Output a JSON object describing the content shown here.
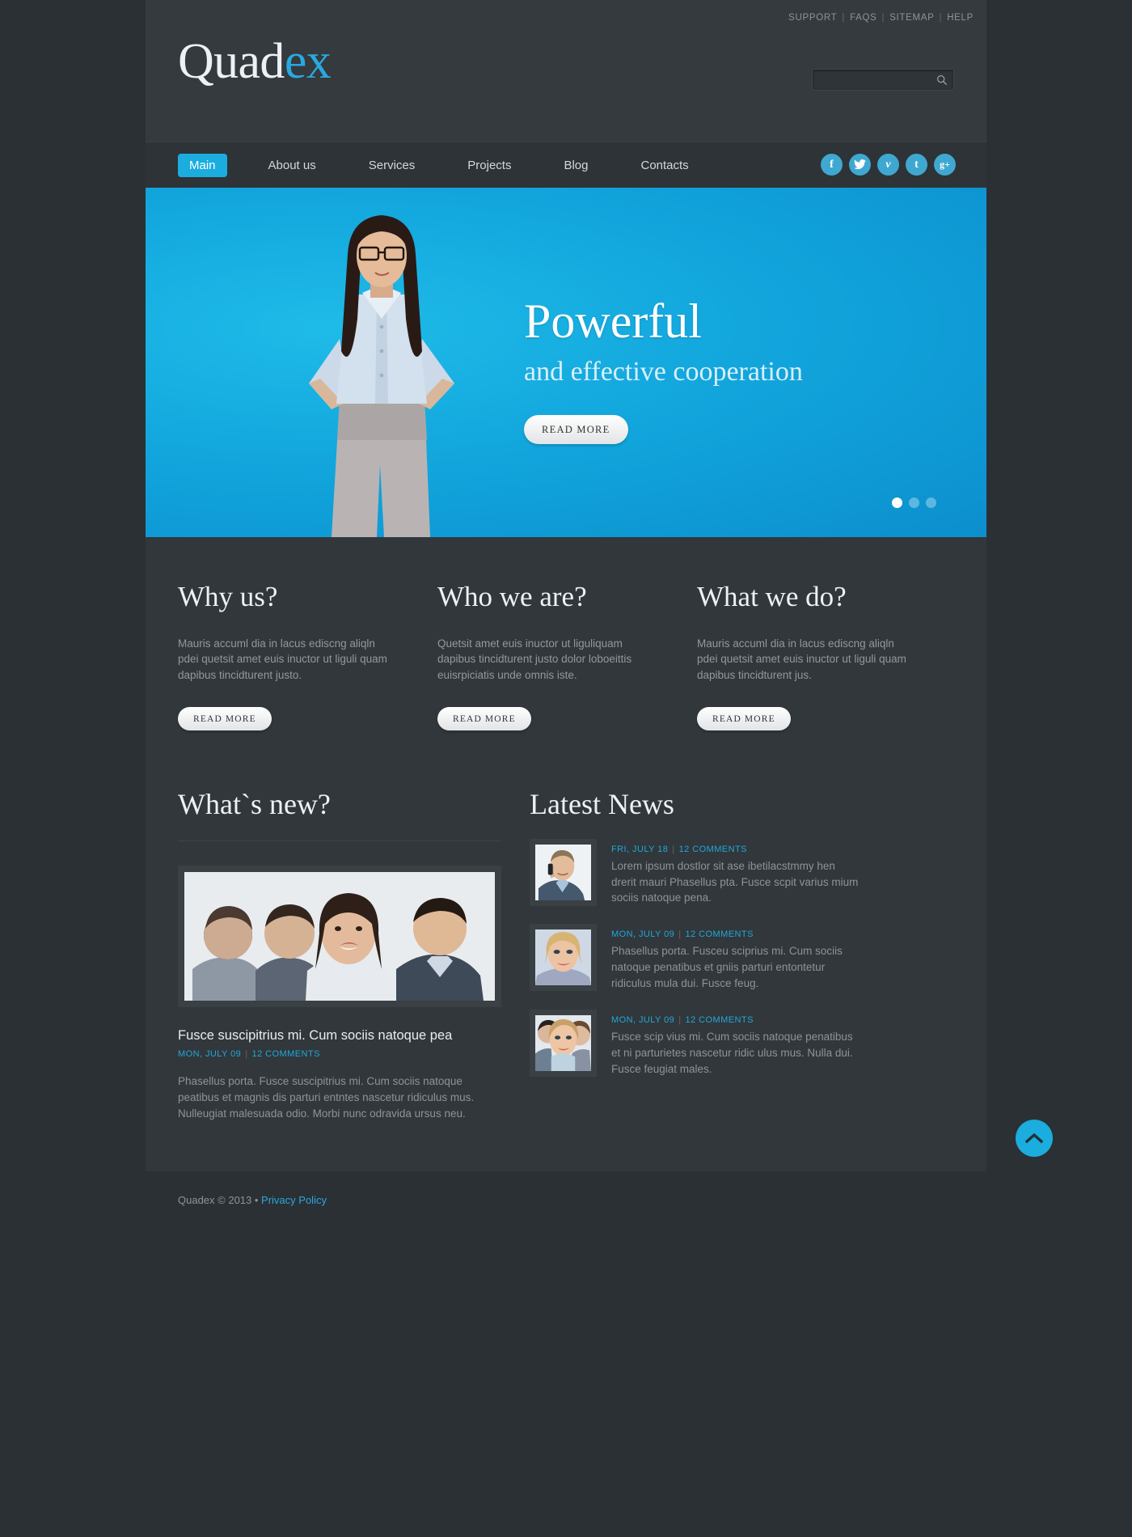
{
  "header": {
    "top_links": [
      {
        "label": "SUPPORT"
      },
      {
        "label": "FAQS"
      },
      {
        "label": "SITEMAP"
      },
      {
        "label": "HELP"
      }
    ],
    "logo_part1": "Quad",
    "logo_part2": "ex",
    "search": {
      "value": "",
      "placeholder": ""
    },
    "icons": {
      "search": "search-icon"
    }
  },
  "nav": {
    "items": [
      {
        "label": "Main",
        "active": true
      },
      {
        "label": "About us",
        "active": false
      },
      {
        "label": "Services",
        "active": false
      },
      {
        "label": "Projects",
        "active": false
      },
      {
        "label": "Blog",
        "active": false
      },
      {
        "label": "Contacts",
        "active": false
      }
    ],
    "socials": [
      {
        "name": "facebook-icon",
        "glyph": "f"
      },
      {
        "name": "twitter-icon",
        "glyph": "t"
      },
      {
        "name": "vimeo-icon",
        "glyph": "v"
      },
      {
        "name": "tumblr-icon",
        "glyph": "t"
      },
      {
        "name": "googleplus-icon",
        "glyph": "g+"
      }
    ]
  },
  "slider": {
    "headline": "Powerful",
    "subheadline": "and effective cooperation",
    "button_label": "READ MORE",
    "dots": [
      {
        "active": true
      },
      {
        "active": false
      },
      {
        "active": false
      }
    ]
  },
  "columns": [
    {
      "title": "Why us?",
      "text": "Mauris accuml dia in lacus ediscng aliqln pdei quetsit amet euis inuctor ut liguli quam dapibus tincidturent justo.",
      "button_label": "READ MORE"
    },
    {
      "title": "Who we are?",
      "text": "Quetsit amet euis inuctor ut liguliquam dapibus tincidturent justo dolor loboeittis euisrpiciatis unde omnis iste.",
      "button_label": "READ MORE"
    },
    {
      "title": "What we do?",
      "text": "Mauris accuml dia in lacus ediscng aliqln pdei quetsit amet euis inuctor ut liguli quam dapibus tincidturent jus.",
      "button_label": "READ MORE"
    }
  ],
  "whats_new": {
    "heading": "What`s new?",
    "post_title": "Fusce suscipitrius mi. Cum sociis natoque pea",
    "date": "MON, JULY 09",
    "comments": "12 COMMENTS",
    "body": "Phasellus porta. Fusce suscipitrius mi. Cum sociis natoque peatibus et magnis dis parturi entntes nascetur ridiculus mus. Nulleugiat malesuada odio. Morbi nunc odravida ursus neu."
  },
  "latest_news": {
    "heading": "Latest News",
    "items": [
      {
        "date": "FRI, JULY 18",
        "comments": "12 COMMENTS",
        "body": "Lorem ipsum dostlor sit ase ibetilacstmmy hen drerit mauri Phasellus pta. Fusce scpit varius mium sociis natoque pena."
      },
      {
        "date": "MON, JULY 09",
        "comments": "12 COMMENTS",
        "body": "Phasellus porta. Fusceu sciprius mi. Cum sociis natoque penatibus et gniis parturi entontetur ridiculus mula dui. Fusce feug."
      },
      {
        "date": "MON, JULY 09",
        "comments": "12 COMMENTS",
        "body": "Fusce scip vius mi. Cum sociis natoque penatibus et ni parturietes nascetur ridic ulus mus. Nulla dui. Fusce feugiat males."
      }
    ]
  },
  "footer": {
    "copyright": "Quadex © 2013 •",
    "privacy_label": "Privacy Policy"
  },
  "to_top": {
    "icon": "chevron-up-icon"
  },
  "colors": {
    "accent": "#1badde",
    "link": "#29a9e0",
    "meta": "#22a7d8",
    "page_bg": "#2b3034",
    "panel_bg": "#31373b",
    "header_bg": "#343a3e"
  }
}
